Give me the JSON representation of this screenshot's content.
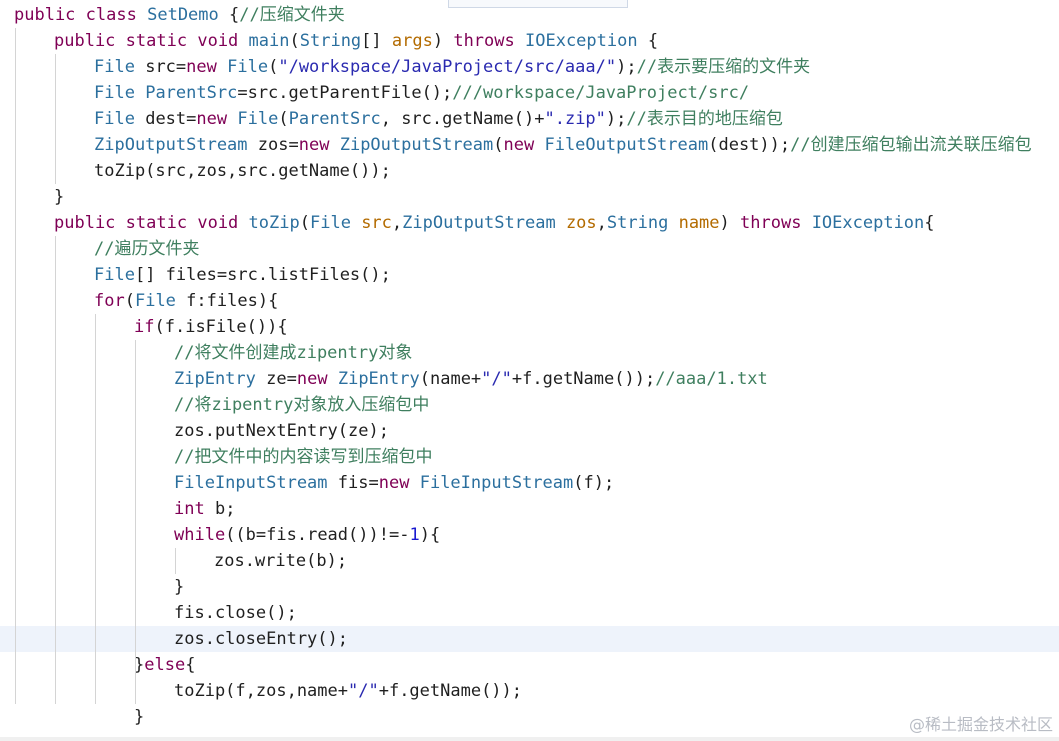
{
  "watermark": "@稀土掘金技术社区",
  "colors": {
    "keyword": "#7f0055",
    "type": "#2b6f9e",
    "string": "#2a2ab0",
    "comment": "#3f7f5f",
    "parameter": "#b36b00",
    "current_line": "#eef3fb"
  },
  "code_lines": [
    {
      "indent": 0,
      "tokens": [
        [
          "kw",
          "public"
        ],
        [
          "punc",
          " "
        ],
        [
          "kw",
          "class"
        ],
        [
          "punc",
          " "
        ],
        [
          "ty",
          "SetDemo"
        ],
        [
          "punc",
          " {"
        ],
        [
          "cm",
          "//压缩文件夹"
        ]
      ]
    },
    {
      "indent": 1,
      "tokens": [
        [
          "kw",
          "public"
        ],
        [
          "punc",
          " "
        ],
        [
          "kw",
          "static"
        ],
        [
          "punc",
          " "
        ],
        [
          "kw",
          "void"
        ],
        [
          "punc",
          " "
        ],
        [
          "ty",
          "main"
        ],
        [
          "punc",
          "("
        ],
        [
          "ty",
          "String"
        ],
        [
          "punc",
          "[] "
        ],
        [
          "prm",
          "args"
        ],
        [
          "punc",
          ") "
        ],
        [
          "kw",
          "throws"
        ],
        [
          "punc",
          " "
        ],
        [
          "ty",
          "IOException"
        ],
        [
          "punc",
          " {"
        ]
      ]
    },
    {
      "indent": 2,
      "tokens": [
        [
          "ty",
          "File"
        ],
        [
          "punc",
          " "
        ],
        [
          "id",
          "src"
        ],
        [
          "punc",
          "="
        ],
        [
          "kw",
          "new"
        ],
        [
          "punc",
          " "
        ],
        [
          "ty",
          "File"
        ],
        [
          "punc",
          "("
        ],
        [
          "str",
          "\"/workspace/JavaProject/src/aaa/\""
        ],
        [
          "punc",
          ");"
        ],
        [
          "cm",
          "//表示要压缩的文件夹"
        ]
      ]
    },
    {
      "indent": 2,
      "tokens": [
        [
          "ty",
          "File"
        ],
        [
          "punc",
          " "
        ],
        [
          "ty",
          "ParentSrc"
        ],
        [
          "punc",
          "="
        ],
        [
          "id",
          "src.getParentFile();"
        ],
        [
          "cm",
          "///workspace/JavaProject/src/"
        ]
      ]
    },
    {
      "indent": 2,
      "tokens": [
        [
          "ty",
          "File"
        ],
        [
          "punc",
          " "
        ],
        [
          "id",
          "dest"
        ],
        [
          "punc",
          "="
        ],
        [
          "kw",
          "new"
        ],
        [
          "punc",
          " "
        ],
        [
          "ty",
          "File"
        ],
        [
          "punc",
          "("
        ],
        [
          "ty",
          "ParentSrc"
        ],
        [
          "punc",
          ", "
        ],
        [
          "id",
          "src.getName()+"
        ],
        [
          "str",
          "\".zip\""
        ],
        [
          "punc",
          ");"
        ],
        [
          "cm",
          "//表示目的地压缩包"
        ]
      ]
    },
    {
      "indent": 2,
      "tokens": [
        [
          "ty",
          "ZipOutputStream"
        ],
        [
          "punc",
          " "
        ],
        [
          "id",
          "zos"
        ],
        [
          "punc",
          "="
        ],
        [
          "kw",
          "new"
        ],
        [
          "punc",
          " "
        ],
        [
          "ty",
          "ZipOutputStream"
        ],
        [
          "punc",
          "("
        ],
        [
          "kw",
          "new"
        ],
        [
          "punc",
          " "
        ],
        [
          "ty",
          "FileOutputStream"
        ],
        [
          "punc",
          "(dest));"
        ],
        [
          "cm",
          "//创建压缩包输出流关联压缩包"
        ]
      ]
    },
    {
      "indent": 2,
      "tokens": [
        [
          "id",
          "toZip(src,zos,src.getName());"
        ]
      ]
    },
    {
      "indent": 1,
      "tokens": [
        [
          "punc",
          "}"
        ]
      ]
    },
    {
      "indent": 1,
      "tokens": [
        [
          "kw",
          "public"
        ],
        [
          "punc",
          " "
        ],
        [
          "kw",
          "static"
        ],
        [
          "punc",
          " "
        ],
        [
          "kw",
          "void"
        ],
        [
          "punc",
          " "
        ],
        [
          "ty",
          "toZip"
        ],
        [
          "punc",
          "("
        ],
        [
          "ty",
          "File"
        ],
        [
          "punc",
          " "
        ],
        [
          "prm",
          "src"
        ],
        [
          "punc",
          ","
        ],
        [
          "ty",
          "ZipOutputStream"
        ],
        [
          "punc",
          " "
        ],
        [
          "prm",
          "zos"
        ],
        [
          "punc",
          ","
        ],
        [
          "ty",
          "String"
        ],
        [
          "punc",
          " "
        ],
        [
          "prm",
          "name"
        ],
        [
          "punc",
          ") "
        ],
        [
          "kw",
          "throws"
        ],
        [
          "punc",
          " "
        ],
        [
          "ty",
          "IOException"
        ],
        [
          "punc",
          "{"
        ]
      ]
    },
    {
      "indent": 2,
      "tokens": [
        [
          "cm",
          "//遍历文件夹"
        ]
      ]
    },
    {
      "indent": 2,
      "tokens": [
        [
          "ty",
          "File"
        ],
        [
          "punc",
          "[] "
        ],
        [
          "id",
          "files"
        ],
        [
          "punc",
          "="
        ],
        [
          "id",
          "src.listFiles();"
        ]
      ]
    },
    {
      "indent": 2,
      "tokens": [
        [
          "kw",
          "for"
        ],
        [
          "punc",
          "("
        ],
        [
          "ty",
          "File"
        ],
        [
          "punc",
          " "
        ],
        [
          "id",
          "f:files"
        ],
        [
          "punc",
          "){"
        ]
      ]
    },
    {
      "indent": 3,
      "tokens": [
        [
          "kw",
          "if"
        ],
        [
          "punc",
          "("
        ],
        [
          "id",
          "f.isFile()"
        ],
        [
          "punc",
          "){"
        ]
      ]
    },
    {
      "indent": 4,
      "tokens": [
        [
          "cm",
          "//将文件创建成zipentry对象"
        ]
      ]
    },
    {
      "indent": 4,
      "tokens": [
        [
          "ty",
          "ZipEntry"
        ],
        [
          "punc",
          " "
        ],
        [
          "id",
          "ze"
        ],
        [
          "punc",
          "="
        ],
        [
          "kw",
          "new"
        ],
        [
          "punc",
          " "
        ],
        [
          "ty",
          "ZipEntry"
        ],
        [
          "punc",
          "("
        ],
        [
          "id",
          "name+"
        ],
        [
          "str",
          "\"/\""
        ],
        [
          "id",
          "+f.getName());"
        ],
        [
          "cm",
          "//aaa/1.txt"
        ]
      ]
    },
    {
      "indent": 4,
      "tokens": [
        [
          "cm",
          "//将zipentry对象放入压缩包中"
        ]
      ]
    },
    {
      "indent": 4,
      "tokens": [
        [
          "id",
          "zos.putNextEntry(ze);"
        ]
      ]
    },
    {
      "indent": 4,
      "tokens": [
        [
          "cm",
          "//把文件中的内容读写到压缩包中"
        ]
      ]
    },
    {
      "indent": 4,
      "tokens": [
        [
          "ty",
          "FileInputStream"
        ],
        [
          "punc",
          " "
        ],
        [
          "id",
          "fis"
        ],
        [
          "punc",
          "="
        ],
        [
          "kw",
          "new"
        ],
        [
          "punc",
          " "
        ],
        [
          "ty",
          "FileInputStream"
        ],
        [
          "punc",
          "(f);"
        ]
      ]
    },
    {
      "indent": 4,
      "tokens": [
        [
          "kw",
          "int"
        ],
        [
          "punc",
          " "
        ],
        [
          "id",
          "b;"
        ]
      ]
    },
    {
      "indent": 4,
      "tokens": [
        [
          "kw",
          "while"
        ],
        [
          "punc",
          "(("
        ],
        [
          "id",
          "b=fis.read()"
        ],
        [
          "punc",
          ")"
        ],
        [
          "punc",
          "!=-"
        ],
        [
          "num",
          "1"
        ],
        [
          "punc",
          "){"
        ]
      ]
    },
    {
      "indent": 5,
      "tokens": [
        [
          "id",
          "zos.write(b);"
        ]
      ]
    },
    {
      "indent": 4,
      "tokens": [
        [
          "punc",
          "}"
        ]
      ]
    },
    {
      "indent": 4,
      "tokens": [
        [
          "id",
          "fis.close();"
        ]
      ]
    },
    {
      "indent": 4,
      "tokens": [
        [
          "id",
          "zos.closeEntry();"
        ]
      ],
      "current": true
    },
    {
      "indent": 3,
      "tokens": [
        [
          "punc",
          "}"
        ],
        [
          "kw",
          "else"
        ],
        [
          "punc",
          "{"
        ]
      ]
    },
    {
      "indent": 4,
      "tokens": [
        [
          "id",
          "toZip(f,zos,name+"
        ],
        [
          "str",
          "\"/\""
        ],
        [
          "id",
          "+f.getName());"
        ]
      ]
    },
    {
      "indent": 3,
      "tokens": [
        [
          "punc",
          "}"
        ]
      ]
    }
  ]
}
